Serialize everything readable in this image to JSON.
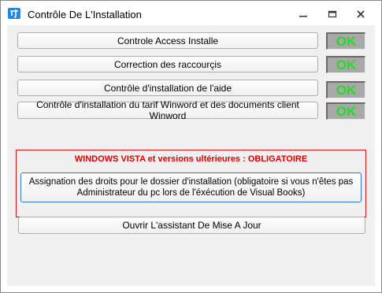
{
  "window": {
    "title": "Contrôle De L'Installation",
    "app_icon": "app-logo-icon",
    "controls": [
      "minimize-icon",
      "restore-icon",
      "close-icon"
    ]
  },
  "checks": [
    {
      "label": "Controle Access Installe",
      "status": "OK"
    },
    {
      "label": "Correction des raccourçis",
      "status": "OK"
    },
    {
      "label": "Contrôle d'installation de l'aide",
      "status": "OK"
    },
    {
      "label": "Contrôle d'installation du tarif Winword et des documents client Winword",
      "status": "OK"
    }
  ],
  "vista": {
    "title": "WINDOWS VISTA et versions ultérieures : OBLIGATOIRE",
    "assign_line1": "Assignation des droits pour le dossier d'installation (obligatoire si vous n'êtes pas",
    "assign_line2": "Administrateur du pc lors de l'éxécution de Visual Books)"
  },
  "update_button": "Ouvrir L'assistant De Mise A Jour",
  "colors": {
    "ok_text": "#22dd22",
    "ok_bg": "#a8a8a8",
    "warning_red": "#e00000",
    "focus_blue": "#2a78c6"
  }
}
